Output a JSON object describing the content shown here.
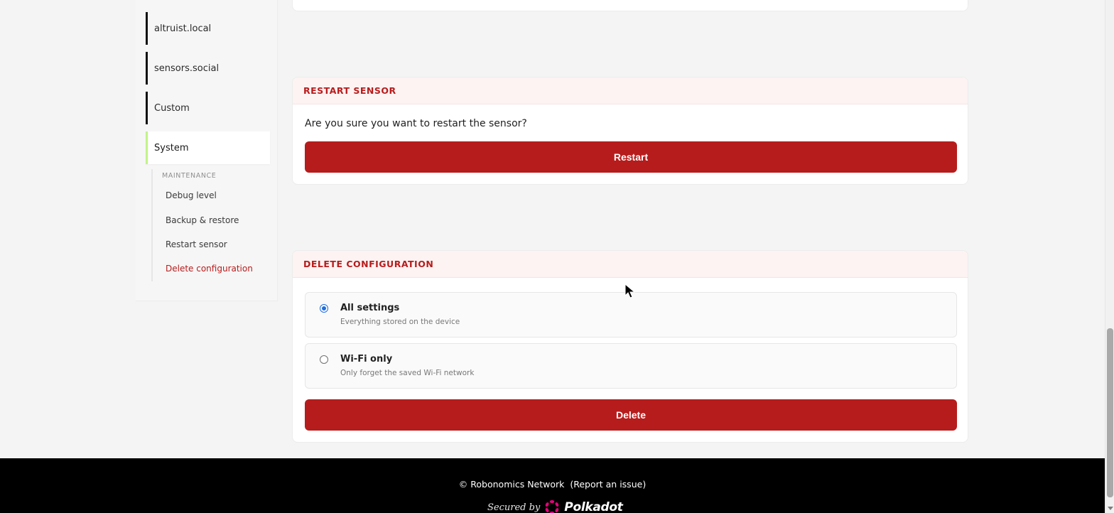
{
  "sidebar": {
    "items": [
      {
        "label": "altruist.local"
      },
      {
        "label": "sensors.social"
      },
      {
        "label": "Custom"
      },
      {
        "label": "System"
      }
    ],
    "active_item": "System",
    "submenu": {
      "heading": "MAINTENANCE",
      "items": [
        {
          "label": "Debug level"
        },
        {
          "label": "Backup & restore"
        },
        {
          "label": "Restart sensor"
        },
        {
          "label": "Delete configuration"
        }
      ]
    }
  },
  "restart_card": {
    "title": "RESTART SENSOR",
    "question": "Are you sure you want to restart the sensor?",
    "button_label": "Restart"
  },
  "delete_card": {
    "title": "DELETE CONFIGURATION",
    "options": [
      {
        "title": "All settings",
        "description": "Everything stored on the device",
        "selected": true
      },
      {
        "title": "Wi-Fi only",
        "description": "Only forget the saved Wi-Fi network",
        "selected": false
      }
    ],
    "button_label": "Delete"
  },
  "footer": {
    "copyright": "© Robonomics Network",
    "report_link": "(Report an issue)",
    "secured_by": "Secured by",
    "brand": "Polkadot"
  },
  "colors": {
    "accent_red": "#b71c1c",
    "active_indicator": "#c2f28a",
    "radio_selected": "#1e6fe0",
    "polkadot_pink": "#e6007a"
  }
}
